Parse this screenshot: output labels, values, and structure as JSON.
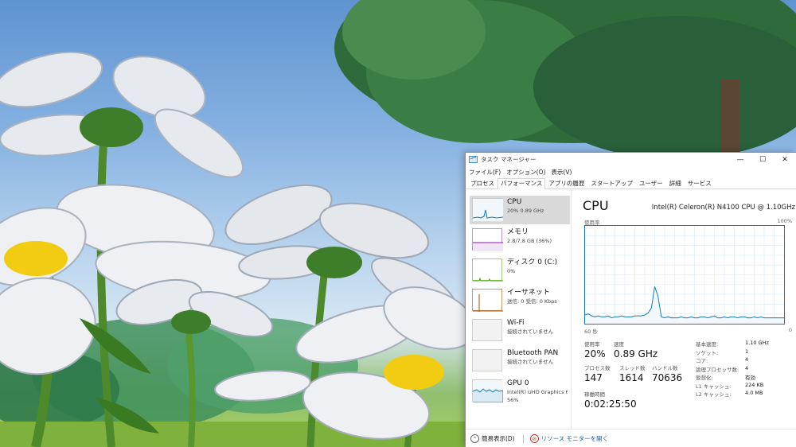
{
  "window": {
    "title": "タスク マネージャー",
    "controls": {
      "minimize": "—",
      "maximize": "☐",
      "close": "✕"
    }
  },
  "menu": [
    "ファイル(F)",
    "オプション(O)",
    "表示(V)"
  ],
  "tabs": [
    {
      "label": "プロセス",
      "active": false
    },
    {
      "label": "パフォーマンス",
      "active": true
    },
    {
      "label": "アプリの履歴",
      "active": false
    },
    {
      "label": "スタートアップ",
      "active": false
    },
    {
      "label": "ユーザー",
      "active": false
    },
    {
      "label": "詳細",
      "active": false
    },
    {
      "label": "サービス",
      "active": false
    }
  ],
  "sidebar": [
    {
      "name": "CPU",
      "sub": "20%  0.89 GHz",
      "color": "#117dbb",
      "selected": true
    },
    {
      "name": "メモリ",
      "sub": "2.8/7.8 GB (36%)",
      "color": "#8b12ae",
      "selected": false
    },
    {
      "name": "ディスク 0 (C:)",
      "sub": "0%",
      "color": "#4da60c",
      "selected": false
    },
    {
      "name": "イーサネット",
      "sub": "送信: 0 受信: 0 Kbps",
      "color": "#a74f01",
      "selected": false
    },
    {
      "name": "Wi-Fi",
      "sub": "接続されていません",
      "color": "#cccccc",
      "selected": false
    },
    {
      "name": "Bluetooth PAN",
      "sub": "接続されていません",
      "color": "#cccccc",
      "selected": false
    },
    {
      "name": "GPU 0",
      "sub": "Intel(R) UHD Graphics 6",
      "sub2": "56%",
      "color": "#117dbb",
      "selected": false
    }
  ],
  "detail": {
    "title": "CPU",
    "model": "Intel(R) Celeron(R) N4100 CPU @ 1.10GHz",
    "util_label": "使用率",
    "util_max": "100%",
    "time_label": "60 秒",
    "time_zero": "0",
    "graph_color": "#117dbb",
    "stats": {
      "usage_label": "使用率",
      "usage_value": "20%",
      "speed_label": "速度",
      "speed_value": "0.89 GHz",
      "process_label": "プロセス数",
      "process_value": "147",
      "thread_label": "スレッド数",
      "thread_value": "1614",
      "handle_label": "ハンドル数",
      "handle_value": "70636",
      "uptime_label": "稼働時間",
      "uptime_value": "0:02:25:50"
    },
    "specs": [
      {
        "k": "基本速度:",
        "v": "1.10 GHz"
      },
      {
        "k": "ソケット:",
        "v": "1"
      },
      {
        "k": "コア:",
        "v": "4"
      },
      {
        "k": "論理プロセッサ数:",
        "v": "4"
      },
      {
        "k": "仮想化:",
        "v": "有効"
      },
      {
        "k": "L1 キャッシュ:",
        "v": "224 KB"
      },
      {
        "k": "L2 キャッシュ:",
        "v": "4.0 MB"
      }
    ]
  },
  "cpu_history": [
    9,
    10,
    8,
    7,
    8,
    7,
    7,
    8,
    6,
    7,
    7,
    8,
    7,
    7,
    7,
    8,
    8,
    8,
    9,
    11,
    16,
    38,
    28,
    7,
    6,
    7,
    6,
    6,
    6,
    7,
    6,
    6,
    7,
    6,
    6,
    7,
    7,
    6,
    7,
    8,
    6,
    6,
    7,
    6,
    7,
    7,
    6,
    7,
    7,
    6,
    6,
    7,
    6,
    7,
    6,
    6,
    6,
    6,
    6,
    6,
    6
  ],
  "footer": {
    "fewer_details": "簡易表示(D)",
    "resource_monitor": "リソース モニターを開く"
  }
}
